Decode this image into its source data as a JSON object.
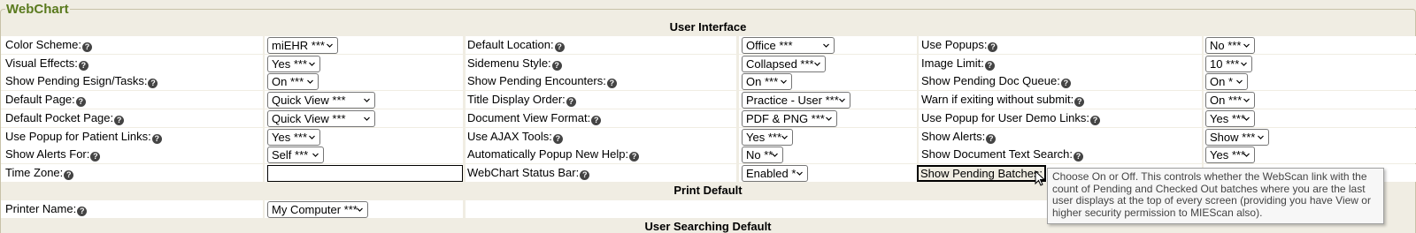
{
  "fieldset": {
    "legend": "WebChart"
  },
  "sections": {
    "user_interface": "User Interface",
    "print_default": "Print Default",
    "user_searching_default": "User Searching Default"
  },
  "rows": [
    {
      "c1": {
        "label": "Color Scheme:",
        "value": "miEHR ***"
      },
      "c2": {
        "label": "Default Location:",
        "value": "Office ***"
      },
      "c3": {
        "label": "Use Popups:",
        "value": "No ***"
      }
    },
    {
      "c1": {
        "label": "Visual Effects:",
        "value": "Yes ***"
      },
      "c2": {
        "label": "Sidemenu Style:",
        "value": "Collapsed ***"
      },
      "c3": {
        "label": "Image Limit:",
        "value": "10 ***"
      }
    },
    {
      "c1": {
        "label": "Show Pending Esign/Tasks:",
        "value": "On ***"
      },
      "c2": {
        "label": "Show Pending Encounters:",
        "value": "On ***"
      },
      "c3": {
        "label": "Show Pending Doc Queue:",
        "value": "On *"
      }
    },
    {
      "c1": {
        "label": "Default Page:",
        "value": "Quick View ***"
      },
      "c2": {
        "label": "Title Display Order:",
        "value": "Practice - User ***"
      },
      "c3": {
        "label": "Warn if exiting without submit:",
        "value": "On ***"
      }
    },
    {
      "c1": {
        "label": "Default Pocket Page:",
        "value": "Quick View ***"
      },
      "c2": {
        "label": "Document View Format:",
        "value": "PDF & PNG ***"
      },
      "c3": {
        "label": "Use Popup for User Demo Links:",
        "value": "Yes ***"
      }
    },
    {
      "c1": {
        "label": "Use Popup for Patient Links:",
        "value": "Yes ***"
      },
      "c2": {
        "label": "Use AJAX Tools:",
        "value": "Yes ***"
      },
      "c3": {
        "label": "Show Alerts:",
        "value": "Show ***"
      }
    },
    {
      "c1": {
        "label": "Show Alerts For:",
        "value": "Self ***"
      },
      "c2": {
        "label": "Automatically Popup New Help:",
        "value": "No **"
      },
      "c3": {
        "label": "Show Document Text Search:",
        "value": "Yes ***"
      }
    },
    {
      "c1": {
        "label": "Time Zone:",
        "value": ""
      },
      "c2": {
        "label": "WebChart Status Bar:",
        "value": "Enabled *"
      },
      "c3": {
        "label": "Show Pending Batches:",
        "value": ""
      }
    }
  ],
  "printer": {
    "label": "Printer Name:",
    "value": "My Computer ***"
  },
  "help_glyph": "?",
  "tooltip": "Choose On or Off. This controls whether the WebScan link with the count of Pending and Checked Out batches where you are the last user displays at the top of every screen (providing you have View or higher security permission to MIEScan also)."
}
